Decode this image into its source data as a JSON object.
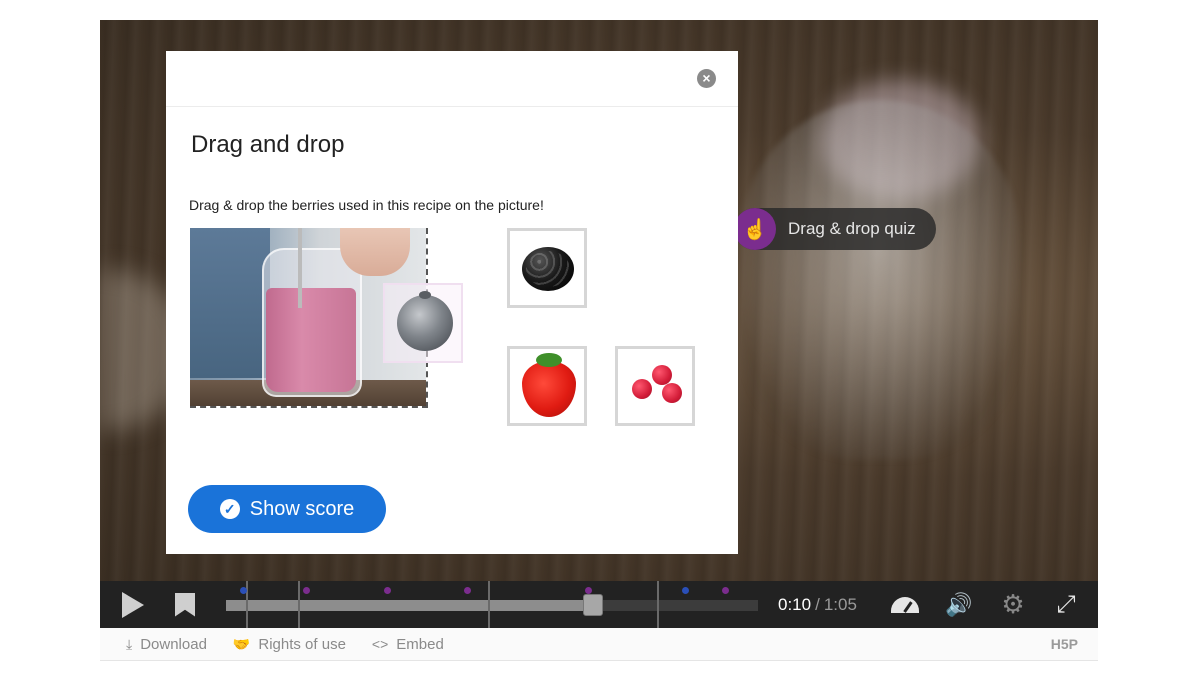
{
  "video": {
    "hotspot_label": "Drag & drop quiz",
    "hotspot_icon": "pointer-hand-icon"
  },
  "dialog": {
    "title": "Drag and drop",
    "instruction": "Drag & drop the berries used in this recipe on the picture!",
    "close_icon": "close-icon",
    "items": [
      "blackberry",
      "strawberry",
      "raspberries"
    ],
    "dropped_item": "blueberry",
    "show_score_label": "Show score",
    "accent": "#1a73d9"
  },
  "controls": {
    "time_current": "0:10",
    "time_separator": "/",
    "time_total": "1:05",
    "progress_fraction": 0.69,
    "icons": [
      "play-icon",
      "bookmark-icon",
      "playback-speed-icon",
      "volume-icon",
      "settings-gear-icon",
      "fullscreen-icon"
    ],
    "marker_colors": [
      "#2a4fb8",
      "#7b2d8e"
    ]
  },
  "footer": {
    "download": "Download",
    "rights": "Rights of use",
    "embed": "Embed",
    "logo": "H5P"
  }
}
